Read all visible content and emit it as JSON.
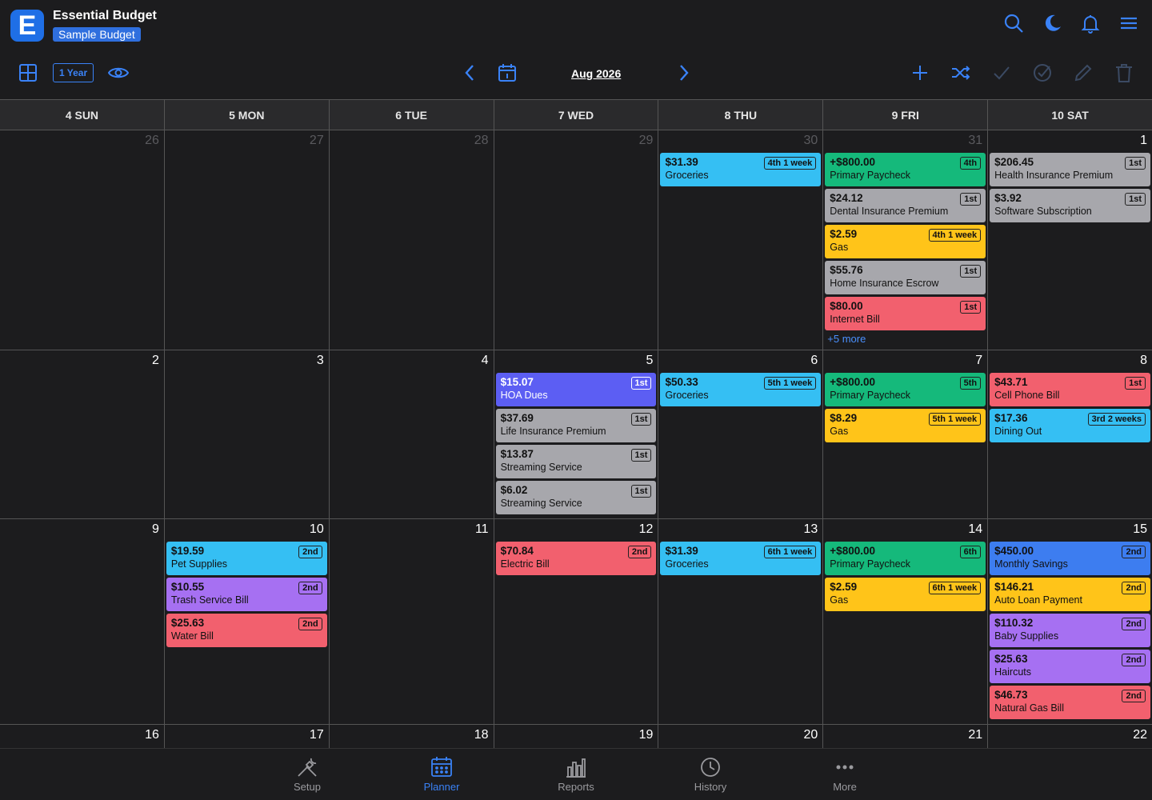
{
  "app": {
    "title": "Essential Budget",
    "budget": "Sample Budget",
    "logo_letter": "E"
  },
  "toolbar": {
    "range_label": "1 Year",
    "month_label": "Aug 2026"
  },
  "weekdays": [
    "4 SUN",
    "5 MON",
    "6 TUE",
    "7 WED",
    "8 THU",
    "9 FRI",
    "10 SAT"
  ],
  "weeks": [
    {
      "days": [
        {
          "num": "26",
          "dim": true,
          "events": []
        },
        {
          "num": "27",
          "dim": true,
          "events": []
        },
        {
          "num": "28",
          "dim": true,
          "events": []
        },
        {
          "num": "29",
          "dim": true,
          "events": []
        },
        {
          "num": "30",
          "dim": true,
          "events": [
            {
              "amount": "$31.39",
              "name": "Groceries",
              "tag": "4th 1 week",
              "color": "blue"
            }
          ]
        },
        {
          "num": "31",
          "dim": true,
          "events": [
            {
              "amount": "+$800.00",
              "name": "Primary Paycheck",
              "tag": "4th",
              "color": "green"
            },
            {
              "amount": "$24.12",
              "name": "Dental Insurance Premium",
              "tag": "1st",
              "color": "gray"
            },
            {
              "amount": "$2.59",
              "name": "Gas",
              "tag": "4th 1 week",
              "color": "yellow"
            },
            {
              "amount": "$55.76",
              "name": "Home Insurance Escrow",
              "tag": "1st",
              "color": "gray"
            },
            {
              "amount": "$80.00",
              "name": "Internet Bill",
              "tag": "1st",
              "color": "red"
            }
          ],
          "more": "+5 more"
        },
        {
          "num": "1",
          "dim": false,
          "events": [
            {
              "amount": "$206.45",
              "name": "Health Insurance Premium",
              "tag": "1st",
              "color": "gray"
            },
            {
              "amount": "$3.92",
              "name": "Software Subscription",
              "tag": "1st",
              "color": "gray"
            }
          ]
        }
      ]
    },
    {
      "days": [
        {
          "num": "2",
          "dim": false,
          "events": []
        },
        {
          "num": "3",
          "dim": false,
          "events": []
        },
        {
          "num": "4",
          "dim": false,
          "events": []
        },
        {
          "num": "5",
          "dim": false,
          "events": [
            {
              "amount": "$15.07",
              "name": "HOA Dues",
              "tag": "1st",
              "color": "indigo"
            },
            {
              "amount": "$37.69",
              "name": "Life Insurance Premium",
              "tag": "1st",
              "color": "gray"
            },
            {
              "amount": "$13.87",
              "name": "Streaming Service",
              "tag": "1st",
              "color": "gray"
            },
            {
              "amount": "$6.02",
              "name": "Streaming Service",
              "tag": "1st",
              "color": "gray"
            }
          ]
        },
        {
          "num": "6",
          "dim": false,
          "events": [
            {
              "amount": "$50.33",
              "name": "Groceries",
              "tag": "5th 1 week",
              "color": "blue"
            }
          ]
        },
        {
          "num": "7",
          "dim": false,
          "events": [
            {
              "amount": "+$800.00",
              "name": "Primary Paycheck",
              "tag": "5th",
              "color": "green"
            },
            {
              "amount": "$8.29",
              "name": "Gas",
              "tag": "5th 1 week",
              "color": "yellow"
            }
          ]
        },
        {
          "num": "8",
          "dim": false,
          "events": [
            {
              "amount": "$43.71",
              "name": "Cell Phone Bill",
              "tag": "1st",
              "color": "red"
            },
            {
              "amount": "$17.36",
              "name": "Dining Out",
              "tag": "3rd 2 weeks",
              "color": "blue"
            }
          ]
        }
      ]
    },
    {
      "days": [
        {
          "num": "9",
          "dim": false,
          "events": []
        },
        {
          "num": "10",
          "dim": false,
          "events": [
            {
              "amount": "$19.59",
              "name": "Pet Supplies",
              "tag": "2nd",
              "color": "blue"
            },
            {
              "amount": "$10.55",
              "name": "Trash Service Bill",
              "tag": "2nd",
              "color": "purple"
            },
            {
              "amount": "$25.63",
              "name": "Water Bill",
              "tag": "2nd",
              "color": "red"
            }
          ]
        },
        {
          "num": "11",
          "dim": false,
          "events": []
        },
        {
          "num": "12",
          "dim": false,
          "events": [
            {
              "amount": "$70.84",
              "name": "Electric Bill",
              "tag": "2nd",
              "color": "red"
            }
          ]
        },
        {
          "num": "13",
          "dim": false,
          "events": [
            {
              "amount": "$31.39",
              "name": "Groceries",
              "tag": "6th 1 week",
              "color": "blue"
            }
          ]
        },
        {
          "num": "14",
          "dim": false,
          "events": [
            {
              "amount": "+$800.00",
              "name": "Primary Paycheck",
              "tag": "6th",
              "color": "green"
            },
            {
              "amount": "$2.59",
              "name": "Gas",
              "tag": "6th 1 week",
              "color": "yellow"
            }
          ]
        },
        {
          "num": "15",
          "dim": false,
          "events": [
            {
              "amount": "$450.00",
              "name": "Monthly Savings",
              "tag": "2nd",
              "color": "royal"
            },
            {
              "amount": "$146.21",
              "name": "Auto Loan Payment",
              "tag": "2nd",
              "color": "yellow"
            },
            {
              "amount": "$110.32",
              "name": "Baby Supplies",
              "tag": "2nd",
              "color": "purple"
            },
            {
              "amount": "$25.63",
              "name": "Haircuts",
              "tag": "2nd",
              "color": "purple"
            },
            {
              "amount": "$46.73",
              "name": "Natural Gas Bill",
              "tag": "2nd",
              "color": "red"
            }
          ]
        }
      ]
    },
    {
      "days": [
        {
          "num": "16",
          "dim": false,
          "events": []
        },
        {
          "num": "17",
          "dim": false,
          "events": []
        },
        {
          "num": "18",
          "dim": false,
          "events": []
        },
        {
          "num": "19",
          "dim": false,
          "events": []
        },
        {
          "num": "20",
          "dim": false,
          "events": []
        },
        {
          "num": "21",
          "dim": false,
          "events": []
        },
        {
          "num": "22",
          "dim": false,
          "events": []
        }
      ]
    }
  ],
  "nav": [
    {
      "label": "Setup",
      "icon": "tools-icon",
      "active": false
    },
    {
      "label": "Planner",
      "icon": "calendar-grid-icon",
      "active": true
    },
    {
      "label": "Reports",
      "icon": "bar-chart-icon",
      "active": false
    },
    {
      "label": "History",
      "icon": "clock-icon",
      "active": false
    },
    {
      "label": "More",
      "icon": "ellipsis-icon",
      "active": false
    }
  ],
  "colors": {
    "accent": "#3a82f7",
    "blue": "#35bff3",
    "green": "#15b97b",
    "gray": "#a7a7ac",
    "yellow": "#ffc419",
    "red": "#f2606e",
    "indigo": "#5c5ef3",
    "purple": "#a670f2",
    "royal": "#3d7df0"
  }
}
